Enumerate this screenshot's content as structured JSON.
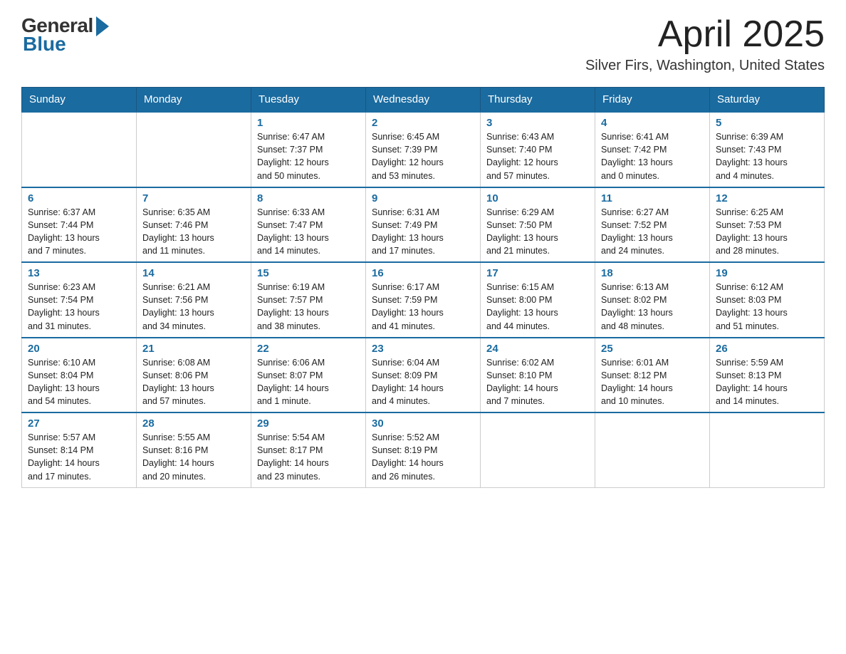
{
  "header": {
    "logo_general": "General",
    "logo_blue": "Blue",
    "title": "April 2025",
    "subtitle": "Silver Firs, Washington, United States"
  },
  "weekdays": [
    "Sunday",
    "Monday",
    "Tuesday",
    "Wednesday",
    "Thursday",
    "Friday",
    "Saturday"
  ],
  "weeks": [
    [
      {
        "day": "",
        "info": ""
      },
      {
        "day": "",
        "info": ""
      },
      {
        "day": "1",
        "info": "Sunrise: 6:47 AM\nSunset: 7:37 PM\nDaylight: 12 hours\nand 50 minutes."
      },
      {
        "day": "2",
        "info": "Sunrise: 6:45 AM\nSunset: 7:39 PM\nDaylight: 12 hours\nand 53 minutes."
      },
      {
        "day": "3",
        "info": "Sunrise: 6:43 AM\nSunset: 7:40 PM\nDaylight: 12 hours\nand 57 minutes."
      },
      {
        "day": "4",
        "info": "Sunrise: 6:41 AM\nSunset: 7:42 PM\nDaylight: 13 hours\nand 0 minutes."
      },
      {
        "day": "5",
        "info": "Sunrise: 6:39 AM\nSunset: 7:43 PM\nDaylight: 13 hours\nand 4 minutes."
      }
    ],
    [
      {
        "day": "6",
        "info": "Sunrise: 6:37 AM\nSunset: 7:44 PM\nDaylight: 13 hours\nand 7 minutes."
      },
      {
        "day": "7",
        "info": "Sunrise: 6:35 AM\nSunset: 7:46 PM\nDaylight: 13 hours\nand 11 minutes."
      },
      {
        "day": "8",
        "info": "Sunrise: 6:33 AM\nSunset: 7:47 PM\nDaylight: 13 hours\nand 14 minutes."
      },
      {
        "day": "9",
        "info": "Sunrise: 6:31 AM\nSunset: 7:49 PM\nDaylight: 13 hours\nand 17 minutes."
      },
      {
        "day": "10",
        "info": "Sunrise: 6:29 AM\nSunset: 7:50 PM\nDaylight: 13 hours\nand 21 minutes."
      },
      {
        "day": "11",
        "info": "Sunrise: 6:27 AM\nSunset: 7:52 PM\nDaylight: 13 hours\nand 24 minutes."
      },
      {
        "day": "12",
        "info": "Sunrise: 6:25 AM\nSunset: 7:53 PM\nDaylight: 13 hours\nand 28 minutes."
      }
    ],
    [
      {
        "day": "13",
        "info": "Sunrise: 6:23 AM\nSunset: 7:54 PM\nDaylight: 13 hours\nand 31 minutes."
      },
      {
        "day": "14",
        "info": "Sunrise: 6:21 AM\nSunset: 7:56 PM\nDaylight: 13 hours\nand 34 minutes."
      },
      {
        "day": "15",
        "info": "Sunrise: 6:19 AM\nSunset: 7:57 PM\nDaylight: 13 hours\nand 38 minutes."
      },
      {
        "day": "16",
        "info": "Sunrise: 6:17 AM\nSunset: 7:59 PM\nDaylight: 13 hours\nand 41 minutes."
      },
      {
        "day": "17",
        "info": "Sunrise: 6:15 AM\nSunset: 8:00 PM\nDaylight: 13 hours\nand 44 minutes."
      },
      {
        "day": "18",
        "info": "Sunrise: 6:13 AM\nSunset: 8:02 PM\nDaylight: 13 hours\nand 48 minutes."
      },
      {
        "day": "19",
        "info": "Sunrise: 6:12 AM\nSunset: 8:03 PM\nDaylight: 13 hours\nand 51 minutes."
      }
    ],
    [
      {
        "day": "20",
        "info": "Sunrise: 6:10 AM\nSunset: 8:04 PM\nDaylight: 13 hours\nand 54 minutes."
      },
      {
        "day": "21",
        "info": "Sunrise: 6:08 AM\nSunset: 8:06 PM\nDaylight: 13 hours\nand 57 minutes."
      },
      {
        "day": "22",
        "info": "Sunrise: 6:06 AM\nSunset: 8:07 PM\nDaylight: 14 hours\nand 1 minute."
      },
      {
        "day": "23",
        "info": "Sunrise: 6:04 AM\nSunset: 8:09 PM\nDaylight: 14 hours\nand 4 minutes."
      },
      {
        "day": "24",
        "info": "Sunrise: 6:02 AM\nSunset: 8:10 PM\nDaylight: 14 hours\nand 7 minutes."
      },
      {
        "day": "25",
        "info": "Sunrise: 6:01 AM\nSunset: 8:12 PM\nDaylight: 14 hours\nand 10 minutes."
      },
      {
        "day": "26",
        "info": "Sunrise: 5:59 AM\nSunset: 8:13 PM\nDaylight: 14 hours\nand 14 minutes."
      }
    ],
    [
      {
        "day": "27",
        "info": "Sunrise: 5:57 AM\nSunset: 8:14 PM\nDaylight: 14 hours\nand 17 minutes."
      },
      {
        "day": "28",
        "info": "Sunrise: 5:55 AM\nSunset: 8:16 PM\nDaylight: 14 hours\nand 20 minutes."
      },
      {
        "day": "29",
        "info": "Sunrise: 5:54 AM\nSunset: 8:17 PM\nDaylight: 14 hours\nand 23 minutes."
      },
      {
        "day": "30",
        "info": "Sunrise: 5:52 AM\nSunset: 8:19 PM\nDaylight: 14 hours\nand 26 minutes."
      },
      {
        "day": "",
        "info": ""
      },
      {
        "day": "",
        "info": ""
      },
      {
        "day": "",
        "info": ""
      }
    ]
  ]
}
